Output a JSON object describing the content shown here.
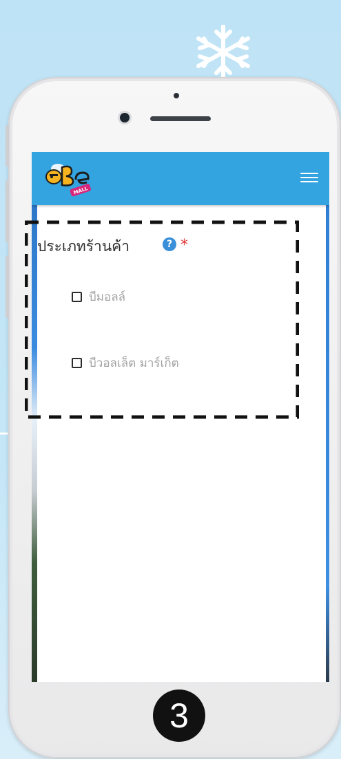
{
  "form": {
    "label": "ประเภทร้านค้า",
    "help_icon": "?",
    "required_marker": "*",
    "options": [
      {
        "label": "บีมอลล์",
        "checked": false
      },
      {
        "label": "บีวอลเล็ต มาร์เก็ต",
        "checked": false
      }
    ]
  },
  "step": {
    "number": "3"
  },
  "icons": {
    "logo": "bemall-logo",
    "menu": "hamburger-icon",
    "help": "question-circle-icon",
    "snowflake": "snowflake-icon"
  },
  "colors": {
    "background": "#c4e6f7",
    "navbar": "#34a4e0",
    "required": "#e03a3a",
    "help": "#3a8fd9",
    "option_text": "#a2a2a2"
  }
}
